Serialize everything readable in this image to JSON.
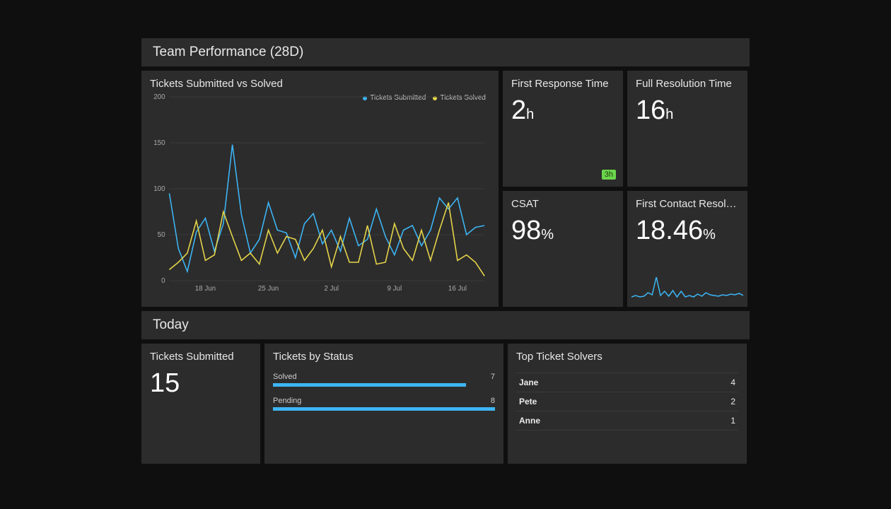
{
  "colors": {
    "submitted": "#3db5f5",
    "solved": "#e6d54a",
    "spark": "#3db5f5",
    "badge_bg": "#6bd64b"
  },
  "section_28d": {
    "title": "Team Performance (28D)",
    "main_chart": {
      "title": "Tickets Submitted vs Solved",
      "legend": {
        "submitted": "Tickets Submitted",
        "solved": "Tickets Solved"
      }
    },
    "first_response": {
      "title": "First Response Time",
      "value": "2",
      "unit": "h",
      "badge": "3h"
    },
    "full_resolution": {
      "title": "Full Resolution Time",
      "value": "16",
      "unit": "h"
    },
    "csat": {
      "title": "CSAT",
      "value": "98",
      "unit": "%"
    },
    "fcr": {
      "title": "First Contact Resol…",
      "value": "18.46",
      "unit": "%"
    }
  },
  "section_today": {
    "title": "Today",
    "tickets_submitted": {
      "title": "Tickets Submitted",
      "value": "15"
    },
    "by_status": {
      "title": "Tickets by Status",
      "rows": [
        {
          "label": "Solved",
          "value": 7,
          "pct": 87
        },
        {
          "label": "Pending",
          "value": 8,
          "pct": 100
        }
      ]
    },
    "top_solvers": {
      "title": "Top Ticket Solvers",
      "rows": [
        {
          "name": "Jane",
          "count": 4
        },
        {
          "name": "Pete",
          "count": 2
        },
        {
          "name": "Anne",
          "count": 1
        }
      ]
    }
  },
  "chart_data": [
    {
      "id": "tickets_submitted_vs_solved",
      "type": "line",
      "title": "Tickets Submitted vs Solved",
      "ylabel": "",
      "ylim": [
        0,
        200
      ],
      "y_ticks": [
        0,
        50,
        100,
        150,
        200
      ],
      "x_tick_labels": [
        "18 Jun",
        "25 Jun",
        "2 Jul",
        "9 Jul",
        "16 Jul"
      ],
      "x_tick_indices": [
        4,
        11,
        18,
        25,
        32
      ],
      "categories_count": 36,
      "series": [
        {
          "name": "Tickets Submitted",
          "color": "#3db5f5",
          "values": [
            95,
            35,
            10,
            53,
            68,
            32,
            62,
            148,
            72,
            30,
            45,
            85,
            55,
            52,
            25,
            62,
            73,
            40,
            55,
            32,
            68,
            38,
            45,
            78,
            48,
            28,
            55,
            60,
            38,
            55,
            90,
            78,
            90,
            50,
            58,
            60
          ]
        },
        {
          "name": "Tickets Solved",
          "color": "#e6d54a",
          "values": [
            12,
            20,
            30,
            65,
            22,
            28,
            75,
            48,
            22,
            30,
            18,
            55,
            30,
            48,
            45,
            22,
            35,
            55,
            15,
            48,
            20,
            20,
            60,
            18,
            20,
            62,
            35,
            22,
            55,
            22,
            55,
            85,
            22,
            28,
            20,
            5
          ]
        }
      ]
    },
    {
      "id": "fcr_sparkline",
      "type": "line",
      "title": "First Contact Resolution trend",
      "ylim": [
        0,
        40
      ],
      "series": [
        {
          "name": "FCR",
          "color": "#3db5f5",
          "values": [
            6,
            8,
            6,
            7,
            12,
            9,
            34,
            8,
            14,
            7,
            15,
            6,
            14,
            6,
            8,
            6,
            10,
            7,
            12,
            9,
            8,
            7,
            9,
            8,
            10,
            9,
            11,
            8
          ]
        }
      ]
    }
  ]
}
